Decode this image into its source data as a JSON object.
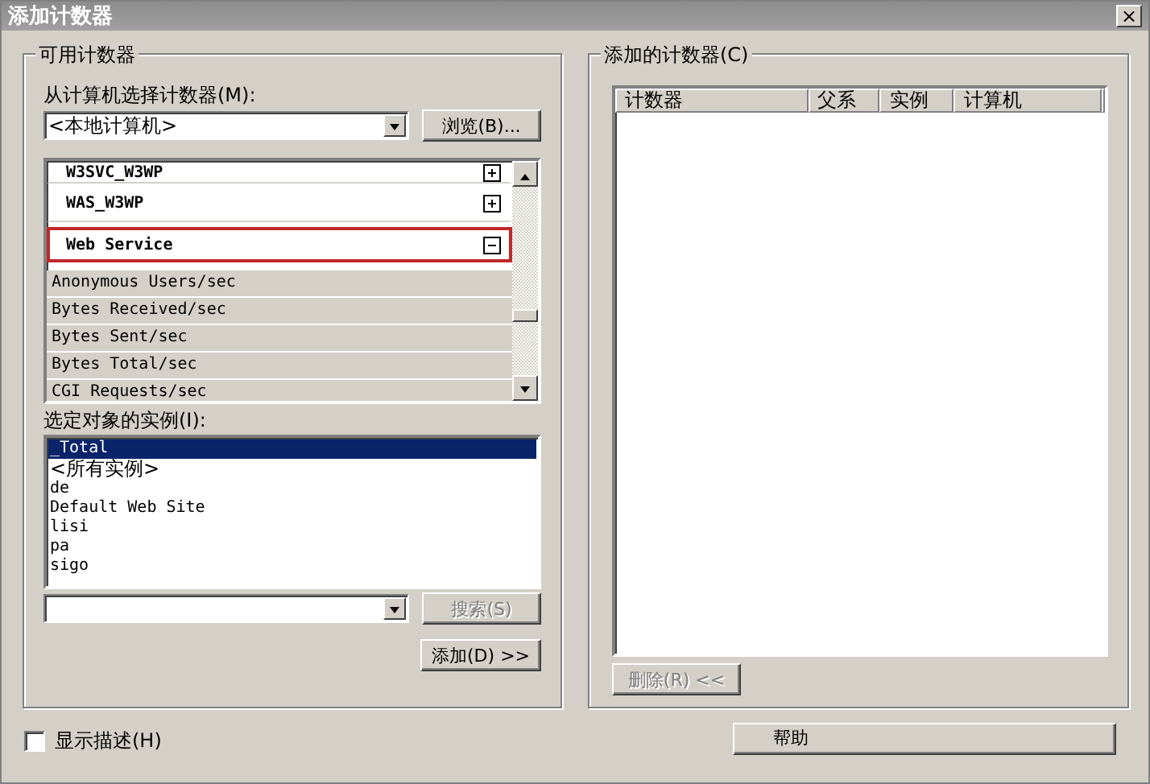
{
  "window": {
    "title": "添加计数器",
    "close": "×"
  },
  "available": {
    "legend": "可用计数器",
    "machine_label": "从计算机选择计数器(M):",
    "machine_value": "<本地计算机>",
    "browse_button": "浏览(B)...",
    "objects": [
      {
        "kind": "object",
        "name": "W3SVC_W3WP",
        "expanded": false,
        "selected": false
      },
      {
        "kind": "object",
        "name": "WAS_W3WP",
        "expanded": false,
        "selected": false
      },
      {
        "kind": "object",
        "name": "Web Service",
        "expanded": true,
        "selected": true
      },
      {
        "kind": "counter",
        "name": "Anonymous Users/sec"
      },
      {
        "kind": "counter",
        "name": "Bytes Received/sec"
      },
      {
        "kind": "counter",
        "name": "Bytes Sent/sec"
      },
      {
        "kind": "counter",
        "name": "Bytes Total/sec"
      },
      {
        "kind": "counter",
        "name": "CGI Requests/sec"
      }
    ],
    "instances_label": "选定对象的实例(I):",
    "instances": [
      {
        "name": "_Total",
        "selected": true
      },
      {
        "name": "<所有实例>",
        "selected": false
      },
      {
        "name": "de",
        "selected": false
      },
      {
        "name": "Default Web Site",
        "selected": false
      },
      {
        "name": "lisi",
        "selected": false
      },
      {
        "name": "pa",
        "selected": false
      },
      {
        "name": "sigo",
        "selected": false
      }
    ],
    "search_button": {
      "label": "搜索(S)",
      "disabled": true
    },
    "add_button": {
      "label": "添加(D) >>",
      "disabled": false
    }
  },
  "added": {
    "legend": "添加的计数器(C)",
    "columns": [
      "计数器",
      "父系",
      "实例",
      "计算机"
    ],
    "remove_button": {
      "label": "删除(R) <<",
      "disabled": true
    }
  },
  "show_description": {
    "label": "显示描述(H)",
    "checked": false
  },
  "help_button": {
    "label": "帮助"
  }
}
